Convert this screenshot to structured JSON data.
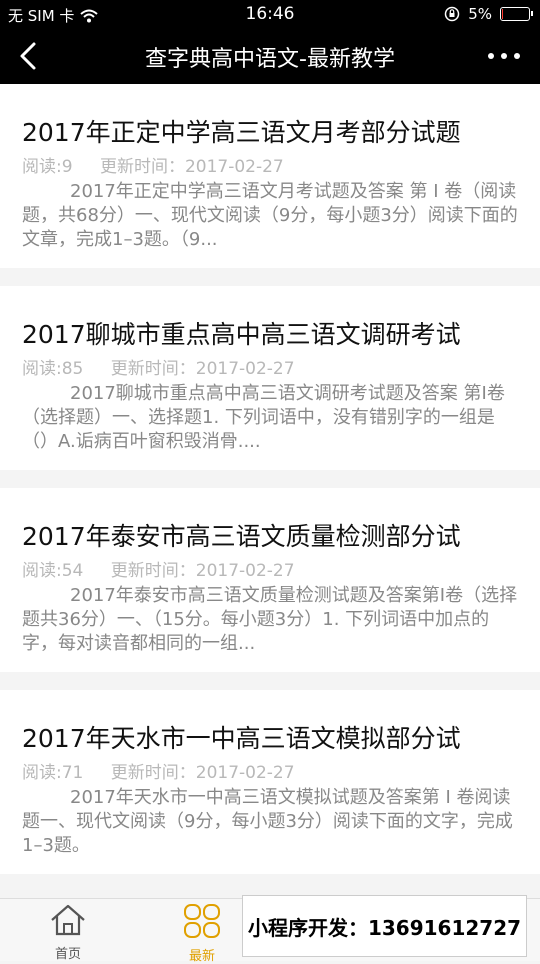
{
  "status_bar": {
    "carrier": "无 SIM 卡",
    "time": "16:46",
    "battery": "5%",
    "battery_level": 0.05
  },
  "navbar": {
    "title": "查字典高中语文-最新教学"
  },
  "articles": [
    {
      "title": "2017年正定中学高三语文月考部分试题",
      "read": "阅读:9",
      "updated": "更新时间：2017-02-27",
      "summary": "2017年正定中学高三语文月考试题及答案 第 I 卷（阅读题，共68分）一、现代文阅读（9分，每小题3分）阅读下面的文章，完成1–3题。（9..."
    },
    {
      "title": "2017聊城市重点高中高三语文调研考试",
      "read": "阅读:85",
      "updated": "更新时间：2017-02-27",
      "summary": "2017聊城市重点高中高三语文调研考试题及答案 第Ⅰ卷（选择题）一、选择题1. 下列词语中，没有错别字的一组是（）A.诟病百叶窗积毁消骨...."
    },
    {
      "title": "2017年泰安市高三语文质量检测部分试",
      "read": "阅读:54",
      "updated": "更新时间：2017-02-27",
      "summary": "2017年泰安市高三语文质量检测试题及答案第Ⅰ卷（选择题共36分）一、（15分。每小题3分）1. 下列词语中加点的字，每对读音都相同的一组..."
    },
    {
      "title": "2017年天水市一中高三语文模拟部分试",
      "read": "阅读:71",
      "updated": "更新时间：2017-02-27",
      "summary": "2017年天水市一中高三语文模拟试题及答案第 I 卷阅读题一、现代文阅读（9分，每小题3分）阅读下面的文字，完成1–3题。"
    }
  ],
  "tabbar": {
    "home": "首页",
    "new": "最新",
    "active_color": "#e0a000"
  },
  "promo": "小程序开发：13691612727"
}
